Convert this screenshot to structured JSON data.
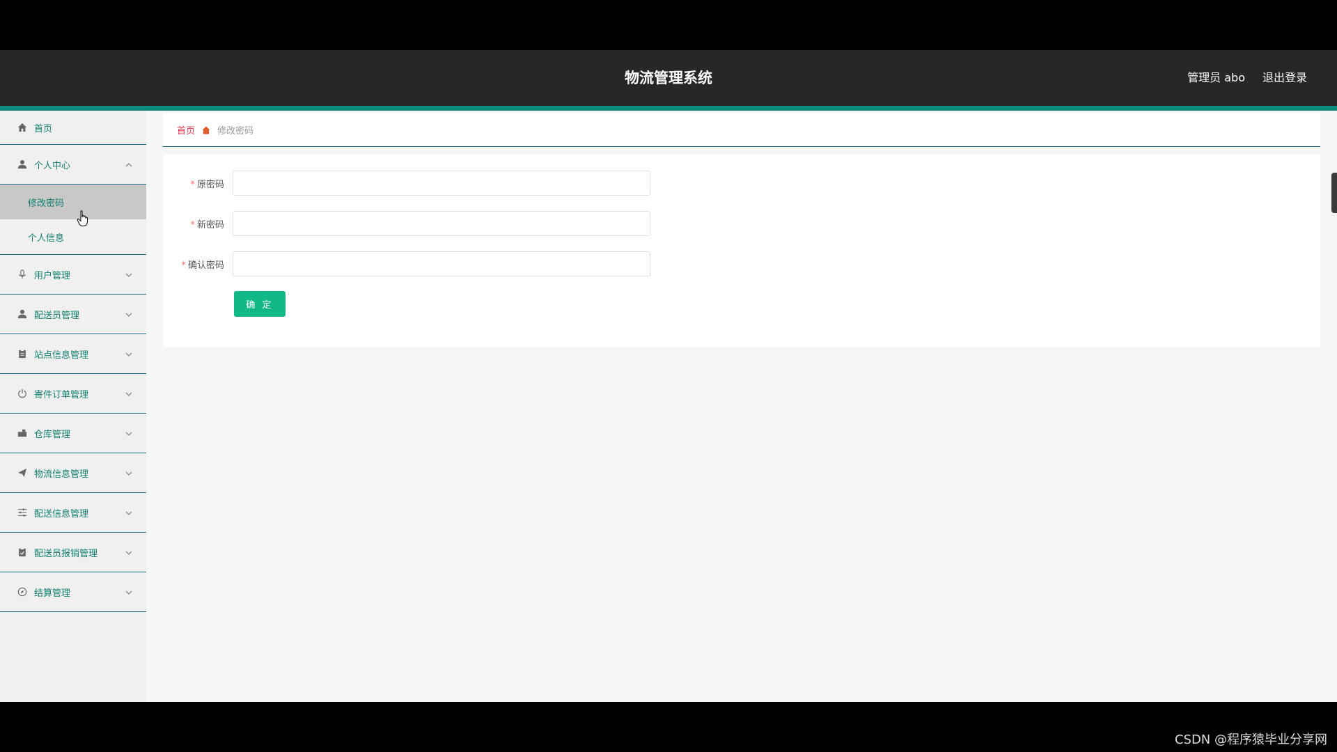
{
  "header": {
    "title": "物流管理系统",
    "user_label": "管理员 abo",
    "logout_label": "退出登录"
  },
  "sidebar": {
    "home": {
      "label": "首页",
      "icon": "home-icon"
    },
    "personal_center": {
      "label": "个人中心",
      "icon": "user-icon",
      "expanded": true,
      "children": [
        {
          "label": "修改密码",
          "active": true
        },
        {
          "label": "个人信息",
          "active": false
        }
      ]
    },
    "groups": [
      {
        "label": "用户管理",
        "icon": "microphone-icon"
      },
      {
        "label": "配送员管理",
        "icon": "user-icon"
      },
      {
        "label": "站点信息管理",
        "icon": "clipboard-icon"
      },
      {
        "label": "寄件订单管理",
        "icon": "power-icon"
      },
      {
        "label": "仓库管理",
        "icon": "truck-icon"
      },
      {
        "label": "物流信息管理",
        "icon": "send-icon"
      },
      {
        "label": "配送信息管理",
        "icon": "sliders-icon"
      },
      {
        "label": "配送员报销管理",
        "icon": "clipboard-check-icon"
      },
      {
        "label": "结算管理",
        "icon": "compass-icon"
      }
    ]
  },
  "breadcrumb": {
    "home": "首页",
    "current": "修改密码"
  },
  "form": {
    "old_password": {
      "label": "原密码",
      "value": "",
      "placeholder": ""
    },
    "new_password": {
      "label": "新密码",
      "value": "",
      "placeholder": ""
    },
    "confirm_password": {
      "label": "确认密码",
      "value": "",
      "placeholder": ""
    },
    "submit_label": "确 定"
  },
  "watermark": "CSDN @程序猿毕业分享网",
  "colors": {
    "topbar": "#272727",
    "accent": "#0f8c7e",
    "menu_text": "#0f7f70",
    "button": "#11b987",
    "breadcrumb_home": "#e0394d"
  }
}
